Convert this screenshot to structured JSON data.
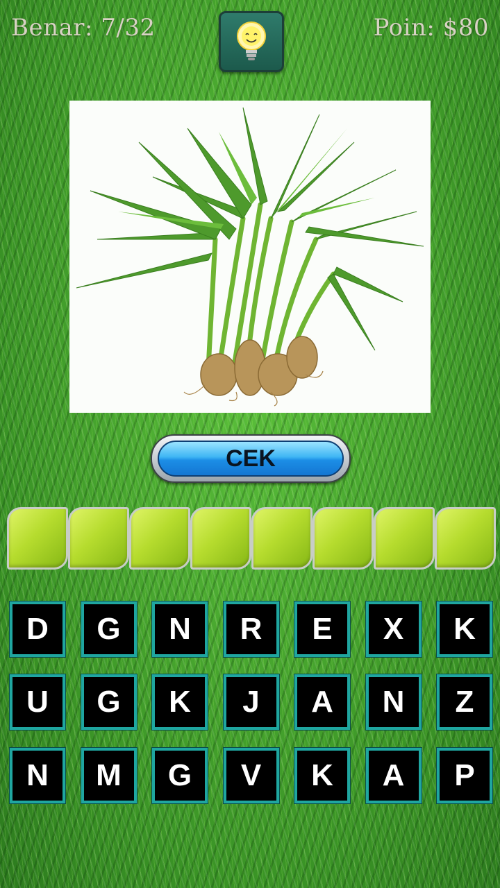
{
  "hud": {
    "score_text": "Benar: 7/32",
    "points_text": "Poin: $80",
    "hint_icon": "lightbulb-icon"
  },
  "picture": {
    "subject": "water spinach (kangkung) bunch",
    "background": "#fbfdfa"
  },
  "check_button": {
    "label": "CEK"
  },
  "answer_slots": {
    "count": 8,
    "filled": [
      "",
      "",
      "",
      "",
      "",
      "",
      "",
      ""
    ]
  },
  "keyboard": {
    "rows": [
      [
        "D",
        "G",
        "N",
        "R",
        "E",
        "X",
        "K"
      ],
      [
        "U",
        "G",
        "K",
        "J",
        "A",
        "N",
        "Z"
      ],
      [
        "N",
        "M",
        "G",
        "V",
        "K",
        "A",
        "P"
      ]
    ]
  },
  "colors": {
    "grass": "#3f9a2a",
    "key_border": "#1fa6a0",
    "slot": "#b6dc2e",
    "button_blue": "#1c8ee6",
    "hud_text": "#d8d2c4"
  }
}
